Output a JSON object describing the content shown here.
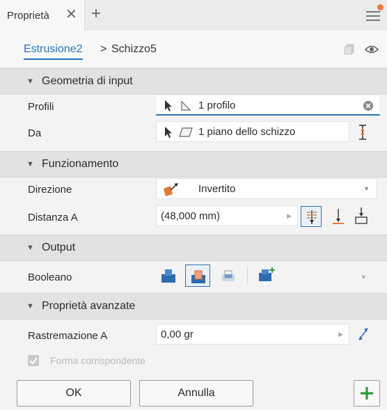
{
  "panel": {
    "tab_label": "Proprietà"
  },
  "breadcrumb": {
    "item1": "Estrusione2",
    "separator": ">",
    "item2": "Schizzo5"
  },
  "sections": {
    "input": {
      "title": "Geometria di input"
    },
    "operation": {
      "title": "Funzionamento"
    },
    "output": {
      "title": "Output"
    },
    "advanced": {
      "title": "Proprietà avanzate"
    }
  },
  "fields": {
    "profiles": {
      "label": "Profili",
      "value": "1 profilo"
    },
    "from": {
      "label": "Da",
      "value": "1 piano dello schizzo"
    },
    "direction": {
      "label": "Direzione",
      "value": "Invertito"
    },
    "distance": {
      "label": "Distanza A",
      "value": "(48,000 mm)"
    },
    "boolean": {
      "label": "Booleano"
    },
    "taper": {
      "label": "Rastremazione A",
      "value": "0,00 gr"
    },
    "match_shape": {
      "label": "Forma corrispondente",
      "checked": true,
      "enabled": false
    }
  },
  "footer": {
    "ok_label": "OK",
    "cancel_label": "Annulla"
  },
  "colors": {
    "accent": "#2a73b8",
    "orange": "#e07b3a",
    "green": "#2e9b3a",
    "boolean_blue": "#2d6cb0"
  },
  "icons": [
    "close-icon",
    "plus-icon",
    "menu-icon",
    "copy-icon",
    "eye-icon",
    "cursor-icon",
    "profile-icon",
    "plane-icon",
    "clear-icon",
    "flip-icon",
    "direction-icon",
    "dropdown-icon",
    "extent-icon",
    "join-icon",
    "cut-icon",
    "intersect-icon",
    "new-solid-icon",
    "taper-icon",
    "add-icon"
  ]
}
